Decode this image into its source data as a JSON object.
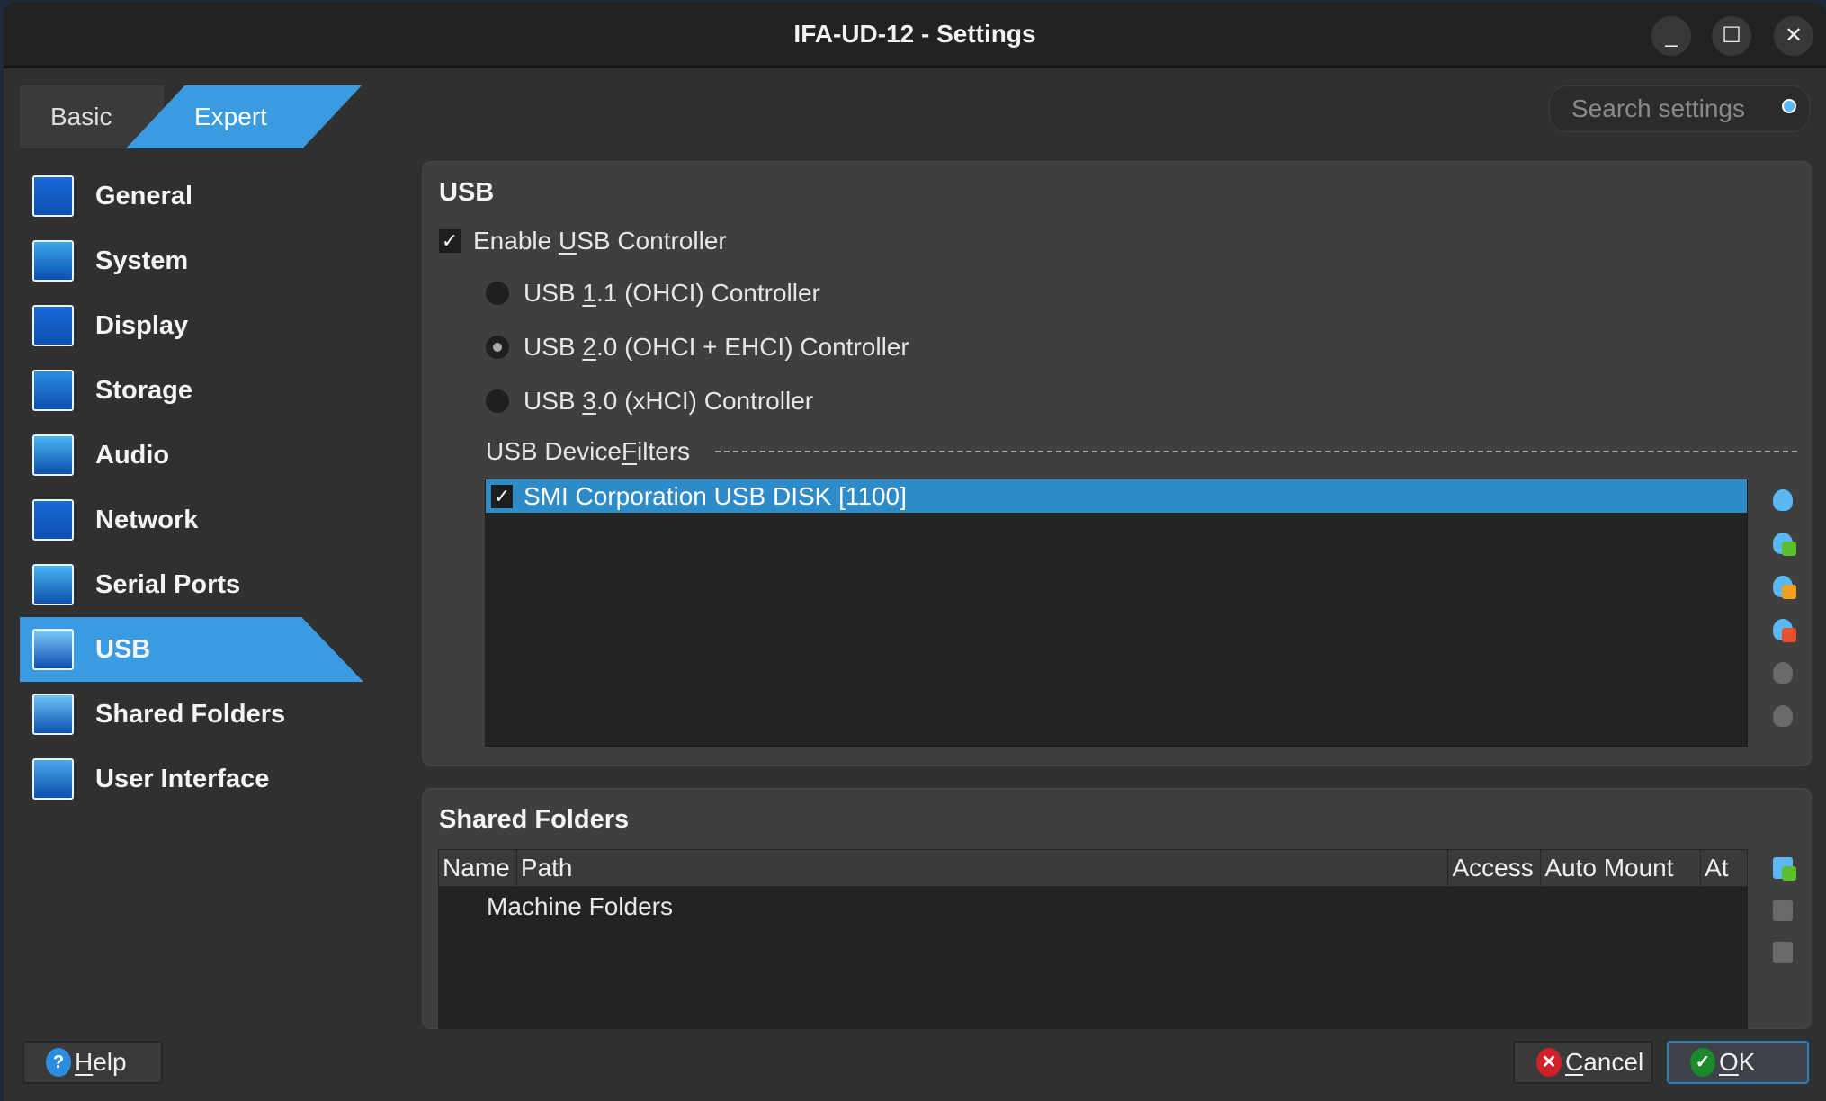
{
  "window": {
    "title": "IFA-UD-12 - Settings",
    "controls": [
      "minimize",
      "maximize",
      "close"
    ]
  },
  "mode_tabs": [
    {
      "label": "Basic",
      "active": false
    },
    {
      "label": "Expert",
      "active": true
    }
  ],
  "search": {
    "placeholder": "Search settings",
    "icon": "search-icon"
  },
  "sidebar": {
    "items": [
      {
        "label": "General",
        "icon": "general-icon",
        "color": "#1a6ad8"
      },
      {
        "label": "System",
        "icon": "system-icon",
        "color": "#3aa8ec"
      },
      {
        "label": "Display",
        "icon": "display-icon",
        "color": "#1a6ad8"
      },
      {
        "label": "Storage",
        "icon": "storage-icon",
        "color": "#2a8de0"
      },
      {
        "label": "Audio",
        "icon": "audio-icon",
        "color": "#48b6f2"
      },
      {
        "label": "Network",
        "icon": "network-icon",
        "color": "#1a6ad8"
      },
      {
        "label": "Serial Ports",
        "icon": "serial-ports-icon",
        "color": "#48b6f2"
      },
      {
        "label": "USB",
        "icon": "usb-icon",
        "color": "#7cc8f6",
        "selected": true
      },
      {
        "label": "Shared Folders",
        "icon": "shared-folders-icon",
        "color": "#6cc4f6"
      },
      {
        "label": "User Interface",
        "icon": "user-interface-icon",
        "color": "#4aa8ea"
      }
    ]
  },
  "usb": {
    "title": "USB",
    "enable": {
      "pre": "Enable ",
      "u": "U",
      "post": "SB Controller",
      "checked": true
    },
    "controllers": [
      {
        "pre": "USB ",
        "u": "1",
        "post": ".1 (OHCI) Controller",
        "selected": false
      },
      {
        "pre": "USB ",
        "u": "2",
        "post": ".0 (OHCI + EHCI) Controller",
        "selected": true
      },
      {
        "pre": "USB ",
        "u": "3",
        "post": ".0 (xHCI) Controller",
        "selected": false
      }
    ],
    "filters_label": {
      "pre": "USB Device ",
      "u": "F",
      "post": "ilters"
    },
    "filters": [
      {
        "label": "SMI Corporation USB DISK [1100]",
        "checked": true
      }
    ],
    "tools": [
      {
        "icon": "add-empty-filter-icon",
        "enabled": true
      },
      {
        "icon": "add-filter-from-device-icon",
        "enabled": true
      },
      {
        "icon": "edit-filter-icon",
        "enabled": true
      },
      {
        "icon": "remove-filter-icon",
        "enabled": true
      },
      {
        "icon": "move-filter-up-icon",
        "enabled": false
      },
      {
        "icon": "move-filter-down-icon",
        "enabled": false
      }
    ]
  },
  "shared_folders": {
    "title": "Shared Folders",
    "columns": [
      "Name",
      "Path",
      "Access",
      "Auto Mount",
      "At"
    ],
    "rows": [
      {
        "name": "Machine Folders"
      }
    ],
    "tools": [
      {
        "icon": "add-shared-folder-icon",
        "enabled": true
      },
      {
        "icon": "edit-shared-folder-icon",
        "enabled": false
      },
      {
        "icon": "remove-shared-folder-icon",
        "enabled": false
      }
    ]
  },
  "buttons": {
    "help": {
      "u": "H",
      "post": "elp"
    },
    "cancel": {
      "u": "C",
      "post": "ancel"
    },
    "ok": {
      "u": "O",
      "post": "K"
    }
  }
}
